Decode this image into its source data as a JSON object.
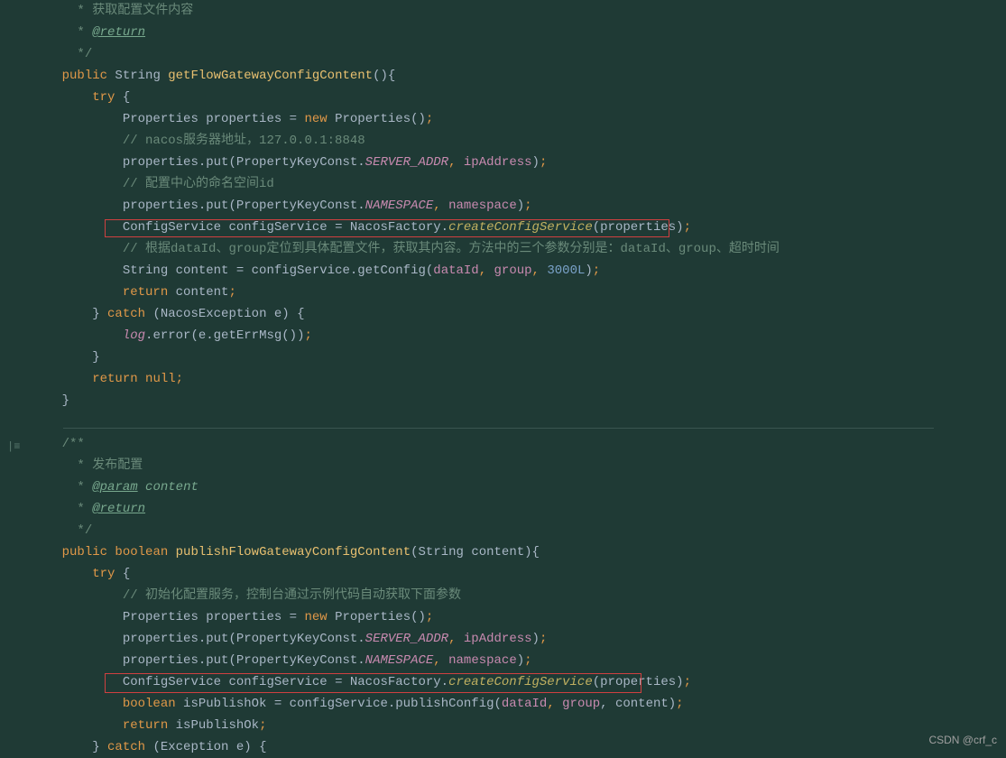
{
  "watermark": "CSDN @crf_c",
  "lines": {
    "l1": " * 获取配置文件内容",
    "l2_star": " * ",
    "l2_tag": "@return",
    "l3": " */",
    "l4_public": "public",
    "l4_string": " String ",
    "l4_method": "getFlowGatewayConfigContent",
    "l4_end": "(){",
    "l5_try": "try",
    "l5_brace": " {",
    "l6_props": "Properties properties = ",
    "l6_new": "new",
    "l6_end": " Properties()",
    "l6_semi": ";",
    "l7": "// nacos服务器地址，127.0.0.1:8848",
    "l8_pre": "properties.put(PropertyKeyConst.",
    "l8_static": "SERVER_ADDR",
    "l8_comma": ", ",
    "l8_ip": "ipAddress",
    "l8_close": ")",
    "l8_semi": ";",
    "l9": "// 配置中心的命名空间id",
    "l10_pre": "properties.put(PropertyKeyConst.",
    "l10_static": "NAMESPACE",
    "l10_comma": ", ",
    "l10_ns": "namespace",
    "l10_close": ")",
    "l10_semi": ";",
    "l11_a": "ConfigService configService = NacosFactory.",
    "l11_m": "createConfigService",
    "l11_b": "(properties)",
    "l11_semi": ";",
    "l12": "// 根据dataId、group定位到具体配置文件，获取其内容。方法中的三个参数分别是：dataId、group、超时时间",
    "l13_pre": "String content = configService.getConfig(",
    "l13_d": "dataId",
    "l13_c1": ", ",
    "l13_g": "group",
    "l13_c2": ", ",
    "l13_num": "3000L",
    "l13_close": ")",
    "l13_semi": ";",
    "l14_ret": "return",
    "l14_var": " content",
    "l14_semi": ";",
    "l15_a": "} ",
    "l15_catch": "catch",
    "l15_b": " (NacosException e) {",
    "l16_log": "log",
    "l16_rest": ".error(e.getErrMsg())",
    "l16_semi": ";",
    "l17": "}",
    "l18_ret": "return",
    "l18_null": " null",
    "l18_semi": ";",
    "l19": "}",
    "l20": "/**",
    "l21": " * 发布配置",
    "l22_star": " * ",
    "l22_tag": "@param",
    "l22_p": " content",
    "l23_star": " * ",
    "l23_tag": "@return",
    "l24": " */",
    "l25_public": "public",
    "l25_bool": " boolean ",
    "l25_method": "publishFlowGatewayConfigContent",
    "l25_param": "(String content){",
    "l26_try": "try",
    "l26_brace": " {",
    "l27": "// 初始化配置服务，控制台通过示例代码自动获取下面参数",
    "l28_props": "Properties properties = ",
    "l28_new": "new",
    "l28_end": " Properties()",
    "l28_semi": ";",
    "l29_pre": "properties.put(PropertyKeyConst.",
    "l29_static": "SERVER_ADDR",
    "l29_comma": ", ",
    "l29_ip": "ipAddress",
    "l29_close": ")",
    "l29_semi": ";",
    "l30_pre": "properties.put(PropertyKeyConst.",
    "l30_static": "NAMESPACE",
    "l30_comma": ", ",
    "l30_ns": "namespace",
    "l30_close": ")",
    "l30_semi": ";",
    "l31_a": "ConfigService configService = NacosFactory.",
    "l31_m": "createConfigService",
    "l31_b": "(properties)",
    "l31_semi": ";",
    "l32_bool": "boolean",
    "l32_a": " isPublishOk = configService.publishConfig(",
    "l32_d": "dataId",
    "l32_c1": ", ",
    "l32_g": "group",
    "l32_c2": ", content)",
    "l32_semi": ";",
    "l33_ret": "return",
    "l33_var": " isPublishOk",
    "l33_semi": ";",
    "l34_a": "} ",
    "l34_catch": "catch",
    "l34_b": " (Exception e) {"
  }
}
